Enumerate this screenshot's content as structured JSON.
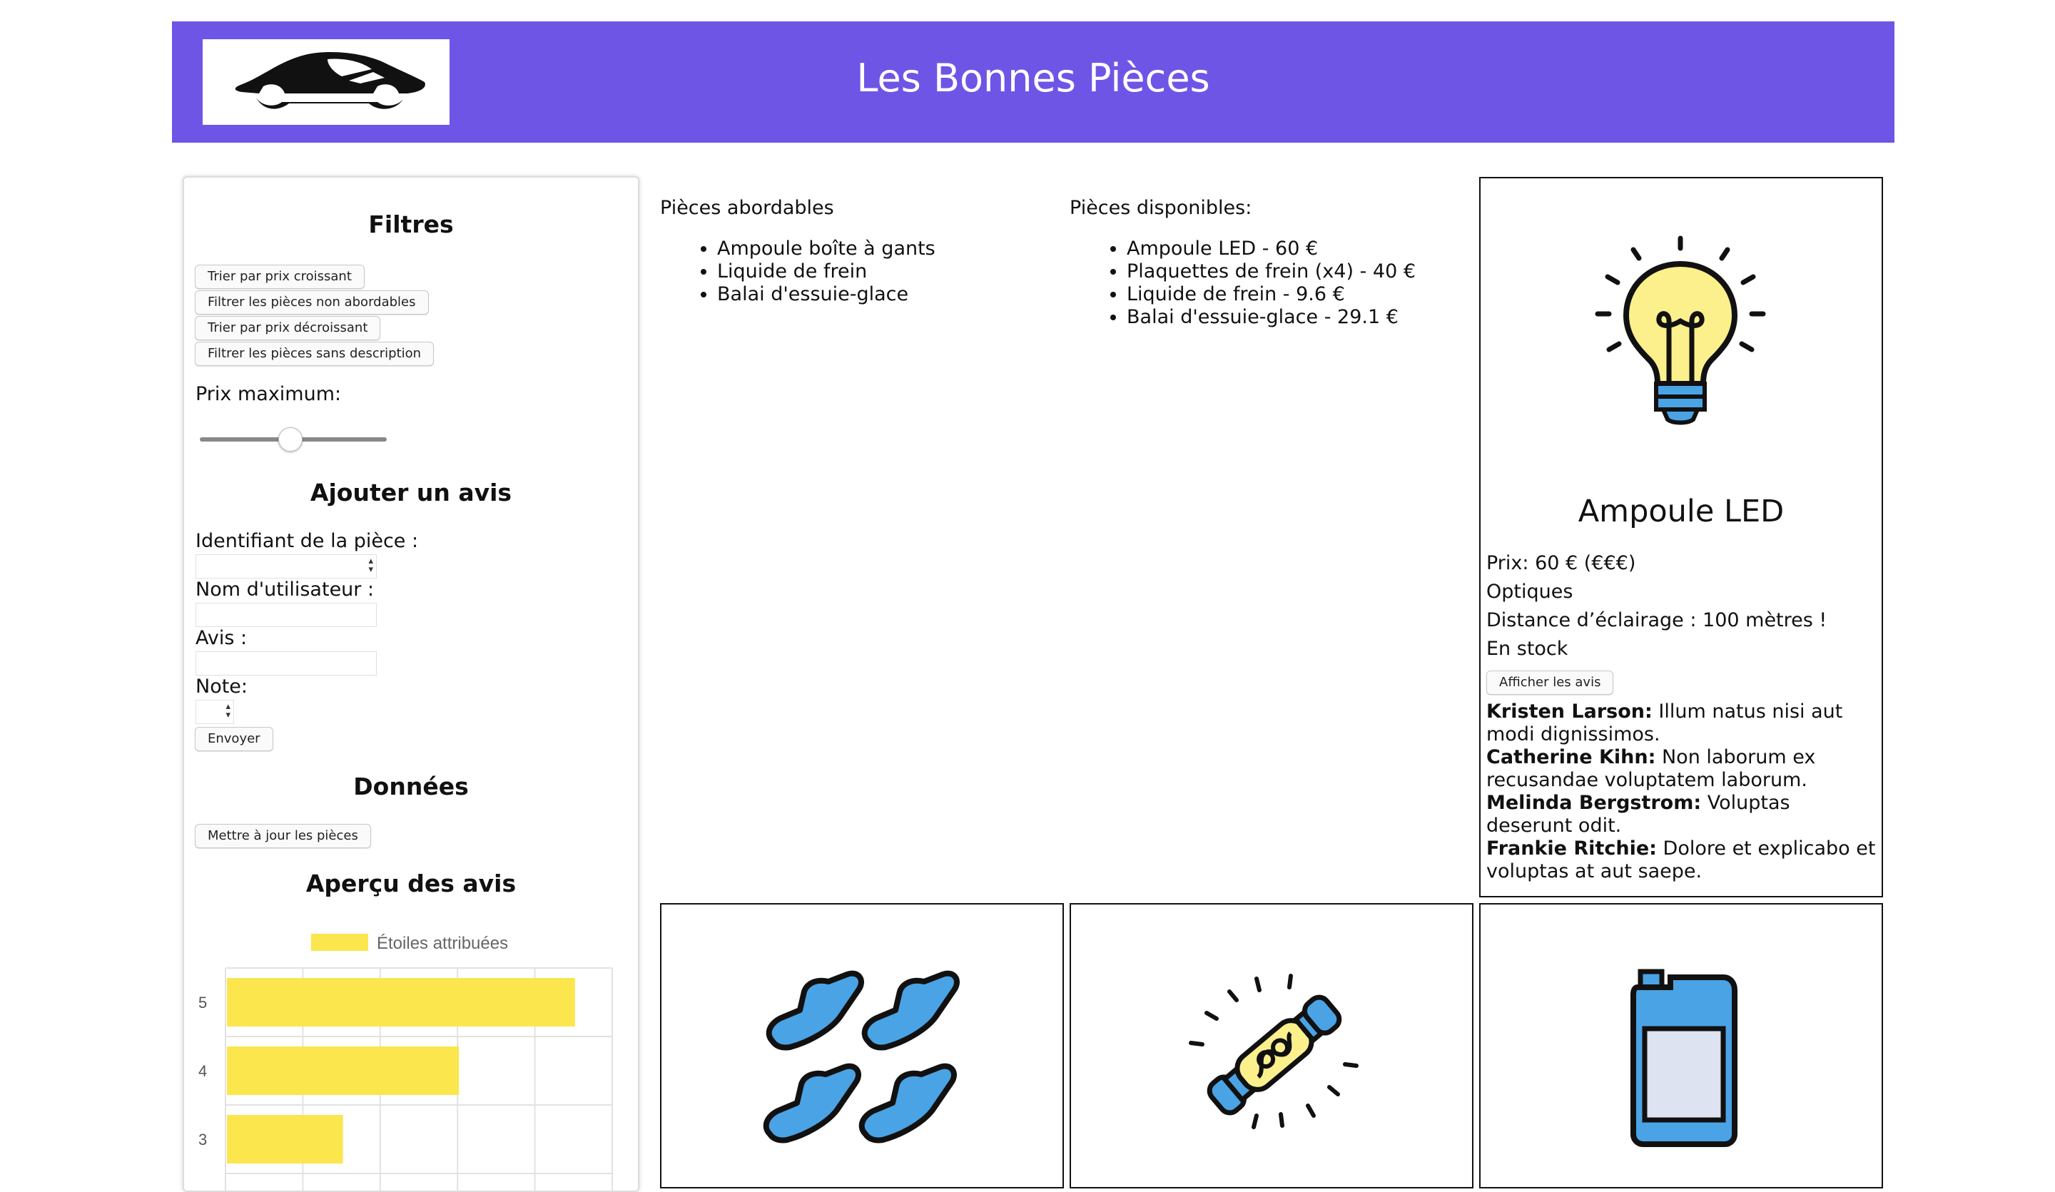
{
  "header": {
    "title": "Les Bonnes Pièces",
    "logo_icon": "car-silhouette-logo"
  },
  "colors": {
    "header_bg": "#6f55e6",
    "bar": "#fbe64d",
    "icon_blue": "#4aa3e4",
    "icon_yellow": "#fbf08c"
  },
  "sidebar": {
    "filters_title": "Filtres",
    "buttons": {
      "sort_asc": "Trier par prix croissant",
      "filter_unaffordable": "Filtrer les pièces non abordables",
      "sort_desc": "Trier par prix décroissant",
      "filter_no_desc": "Filtrer les pièces sans description"
    },
    "max_price_label": "Prix maximum:",
    "max_price_level": 0.5,
    "review_title": "Ajouter un avis",
    "piece_id_label": "Identifiant de la pièce :",
    "username_label": "Nom d'utilisateur :",
    "review_label": "Avis :",
    "rating_label": "Note:",
    "submit_label": "Envoyer",
    "data_title": "Données",
    "update_button": "Mettre à jour les pièces",
    "overview_title": "Aperçu des avis"
  },
  "chart_data": {
    "type": "bar",
    "orientation": "horizontal",
    "legend": [
      "Étoiles attribuées"
    ],
    "legend_position": "top",
    "categories": [
      "5",
      "4",
      "3"
    ],
    "series": [
      {
        "name": "Étoiles attribuées",
        "values": [
          4.5,
          3.0,
          1.5
        ]
      }
    ],
    "grid": true
  },
  "affordable": {
    "title": "Pièces abordables",
    "items": [
      "Ampoule boîte à gants",
      "Liquide de frein",
      "Balai d'essuie-glace"
    ]
  },
  "available": {
    "title": "Pièces disponibles:",
    "items": [
      "Ampoule LED - 60 €",
      "Plaquettes de frein (x4) - 40 €",
      "Liquide de frein - 9.6 €",
      "Balai d'essuie-glace - 29.1 €"
    ]
  },
  "featured": {
    "icon": "light-bulb-icon",
    "name": "Ampoule LED",
    "price": "Prix: 60 € (€€€)",
    "category": "Optiques",
    "description": "Distance d’éclairage : 100 mètres !",
    "stock": "En stock",
    "reviews_button": "Afficher les avis",
    "reviews": [
      {
        "user": "Kristen Larson:",
        "text": " Illum natus nisi aut modi dignissimos."
      },
      {
        "user": "Catherine Kihn:",
        "text": " Non laborum ex recusandae voluptatem laborum."
      },
      {
        "user": "Melinda Bergstrom:",
        "text": " Voluptas deserunt odit."
      },
      {
        "user": "Frankie Ritchie:",
        "text": " Dolore et explicabo et voluptas at aut saepe."
      }
    ]
  },
  "cards": [
    {
      "icon": "brake-pads-icon"
    },
    {
      "icon": "tube-bulb-icon"
    },
    {
      "icon": "fluid-canister-icon"
    }
  ]
}
